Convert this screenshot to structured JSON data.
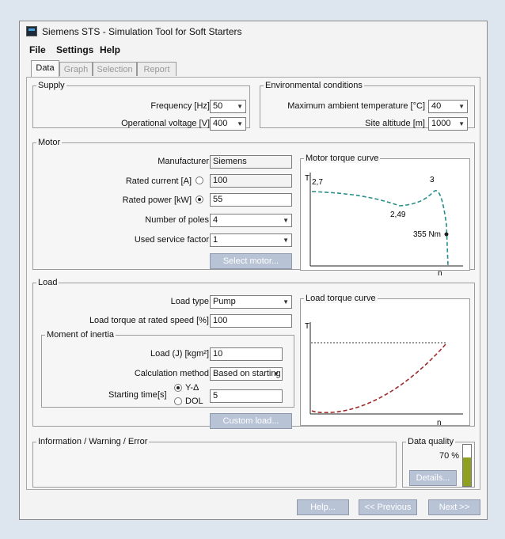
{
  "window": {
    "title": "Siemens STS - Simulation Tool for Soft Starters"
  },
  "menu": [
    "File",
    "Settings",
    "Help"
  ],
  "tabs": [
    "Data",
    "Graph",
    "Selection",
    "Report"
  ],
  "supply": {
    "legend": "Supply",
    "frequency_label": "Frequency  [Hz]",
    "frequency_value": "50",
    "voltage_label": "Operational voltage  [V]",
    "voltage_value": "400"
  },
  "environment": {
    "legend": "Environmental conditions",
    "temp_label": "Maximum ambient temperature  [°C]",
    "temp_value": "40",
    "altitude_label": "Site altitude  [m]",
    "altitude_value": "1000"
  },
  "motor": {
    "legend": "Motor",
    "manufacturer_label": "Manufacturer",
    "manufacturer_value": "Siemens",
    "current_label": "Rated current  [A]",
    "current_value": "100",
    "power_label": "Rated power  [kW]",
    "power_value": "55",
    "poles_label": "Number of poles",
    "poles_value": "4",
    "service_label": "Used service factor",
    "service_value": "1",
    "select_button": "Select motor..."
  },
  "motor_curve": {
    "legend": "Motor torque curve",
    "y_axis": "T",
    "x_axis": "n",
    "labels": {
      "start": "2,7",
      "min": "2,49",
      "max": "3",
      "rated": "355 Nm"
    }
  },
  "load": {
    "legend": "Load",
    "type_label": "Load type",
    "type_value": "Pump",
    "torque_label": "Load torque at rated speed  [%]",
    "torque_value": "100",
    "custom_button": "Custom load..."
  },
  "inertia": {
    "legend": "Moment of inertia",
    "load_label": "Load (J)  [kgm²]",
    "load_value": "10",
    "method_label": "Calculation method",
    "method_value": "Based on starting",
    "starting_label": "Starting time",
    "starting_unit": "[s]",
    "radio_y": "Y-Δ",
    "radio_dol": "DOL",
    "starting_value": "5"
  },
  "load_curve": {
    "legend": "Load torque curve",
    "y_axis": "T",
    "x_axis": "n"
  },
  "info": {
    "legend": "Information / Warning / Error"
  },
  "quality": {
    "legend": "Data quality",
    "value": "70 %",
    "level": 0.7,
    "details_button": "Details..."
  },
  "footer": {
    "help": "Help...",
    "previous": "<< Previous",
    "next": "Next >>"
  },
  "colors": {
    "motor_curve": "#2a8f8a",
    "load_curve": "#a02a2a",
    "quality_fill": "#8fa020",
    "button": "#b8c3d6"
  }
}
